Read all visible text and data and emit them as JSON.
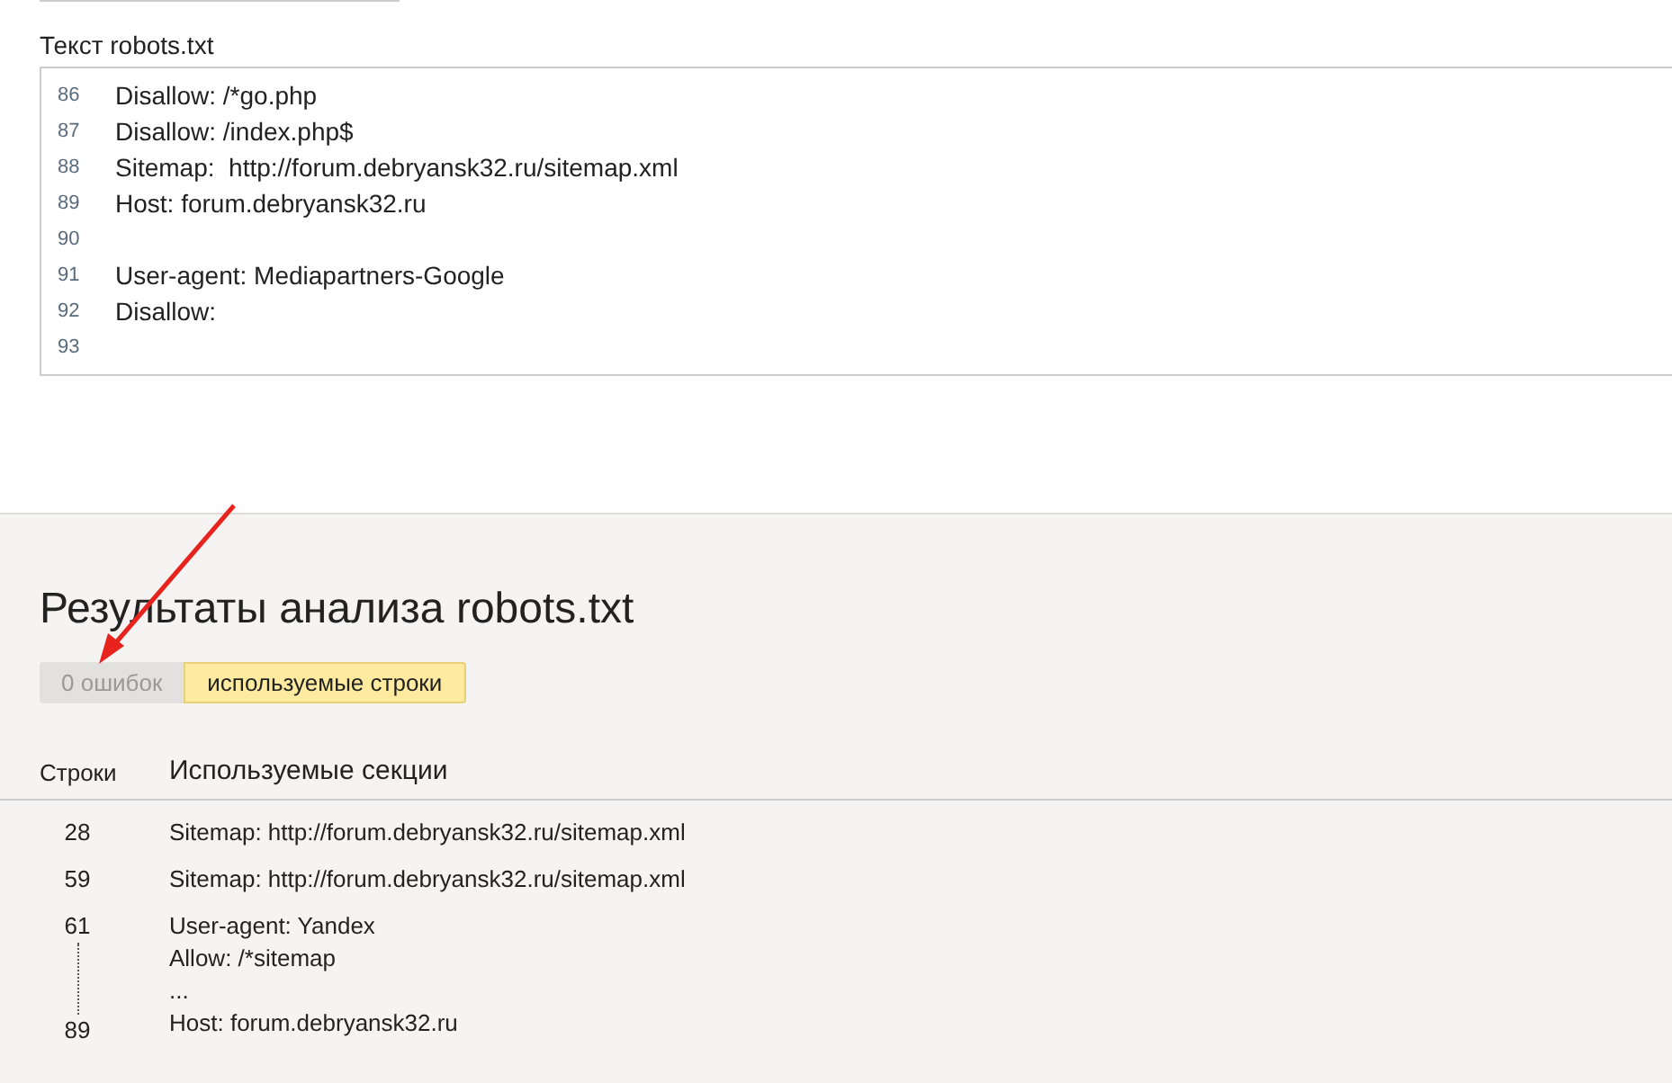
{
  "editor": {
    "label": "Текст robots.txt",
    "lines": [
      {
        "number": "86",
        "text": "Disallow: /*go.php"
      },
      {
        "number": "87",
        "text": "Disallow: /index.php$"
      },
      {
        "number": "88",
        "text": "Sitemap:  http://forum.debryansk32.ru/sitemap.xml"
      },
      {
        "number": "89",
        "text": "Host: forum.debryansk32.ru"
      },
      {
        "number": "90"
      },
      {
        "number": "91",
        "text": "User-agent: Mediapartners-Google"
      },
      {
        "number": "92",
        "text": "Disallow:"
      },
      {
        "number": "93"
      }
    ]
  },
  "results": {
    "title": "Результаты анализа robots.txt",
    "tabs": [
      {
        "label": "0 ошибок",
        "selected": false
      },
      {
        "label": "используемые строки",
        "selected": true
      }
    ],
    "columns": [
      "Строки",
      "Используемые секции"
    ],
    "rows": [
      {
        "line_start": "28",
        "text": [
          "Sitemap: http://forum.debryansk32.ru/sitemap.xml"
        ]
      },
      {
        "line_start": "59",
        "text": [
          "Sitemap: http://forum.debryansk32.ru/sitemap.xml"
        ]
      },
      {
        "line_start": "61",
        "line_end": "89",
        "text": [
          "User-agent: Yandex",
          "Allow: /*sitemap",
          "...",
          "Host: forum.debryansk32.ru"
        ]
      }
    ]
  }
}
